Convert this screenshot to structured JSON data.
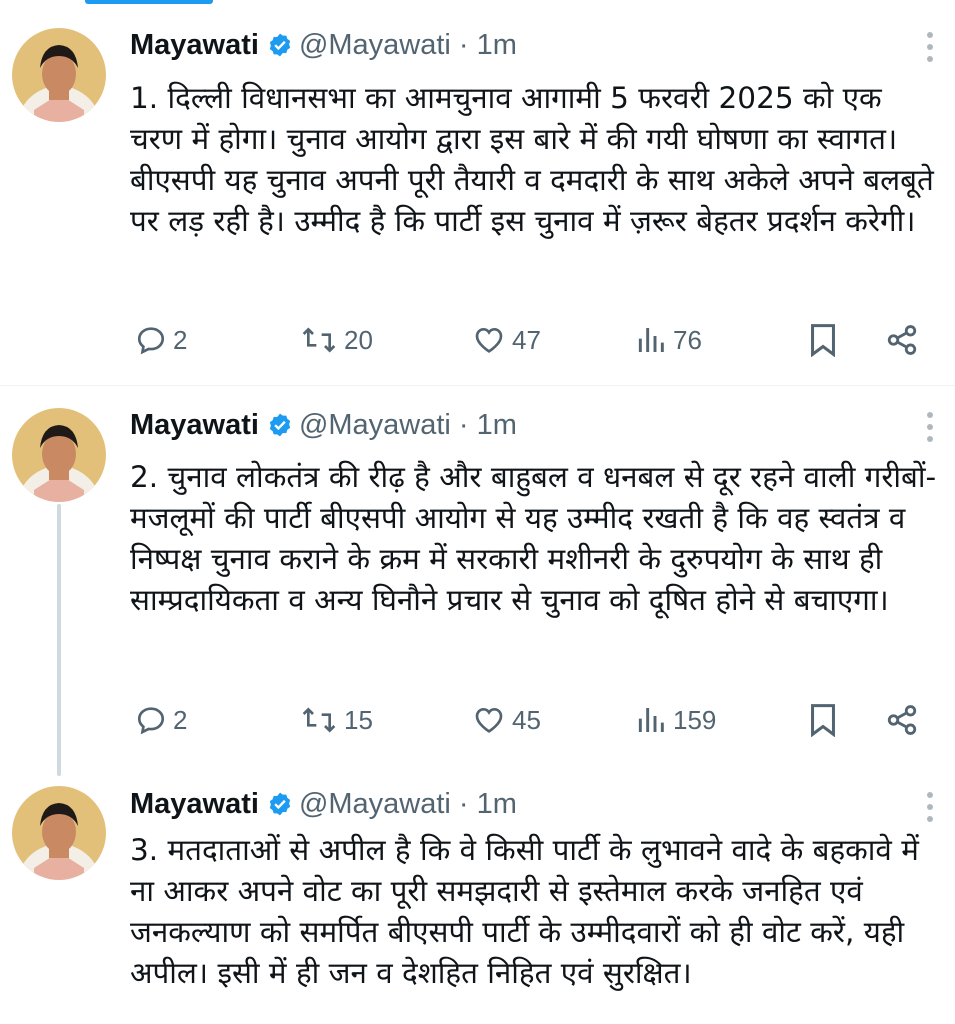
{
  "colors": {
    "accent": "#1d9bf0",
    "text": "#0f1419",
    "muted": "#536471",
    "divider": "#eff3f4",
    "thread": "#cfd9de"
  },
  "tweets": [
    {
      "name": "Mayawati",
      "handle": "@Mayawati",
      "separator": "·",
      "time": "1m",
      "text": "1. दिल्ली विधानसभा का आमचुनाव आगामी 5 फरवरी 2025 को एक चरण में होगा। चुनाव आयोग द्वारा इस बारे में की गयी घोषणा का स्वागत। बीएसपी यह चुनाव अपनी पूरी तैयारी व दमदारी के साथ अकेले अपने बलबूते पर लड़ रही है। उम्मीद है कि पार्टी इस चुनाव में ज़रूर बेहतर प्रदर्शन करेगी।",
      "replies": "2",
      "reposts": "20",
      "likes": "47",
      "views": "76"
    },
    {
      "name": "Mayawati",
      "handle": "@Mayawati",
      "separator": "·",
      "time": "1m",
      "text": "2. चुनाव लोकतंत्र की रीढ़ है और बाहुबल व धनबल से दूर रहने वाली गरीबों-मजलूमों की पार्टी बीएसपी आयोग से यह उम्मीद रखती है कि वह स्वतंत्र व निष्पक्ष चुनाव कराने के क्रम में सरकारी मशीनरी के दुरुपयोग के साथ ही साम्प्रदायिकता व अन्य घिनौने प्रचार से चुनाव को दूषित होने से बचाएगा।",
      "replies": "2",
      "reposts": "15",
      "likes": "45",
      "views": "159"
    },
    {
      "name": "Mayawati",
      "handle": "@Mayawati",
      "separator": "·",
      "time": "1m",
      "text": "3. मतदाताओं से अपील है कि वे किसी पार्टी के लुभावने वादे के बहकावे में ना आकर अपने वोट का पूरी समझदारी से इस्तेमाल करके जनहित एवं जनकल्याण को समर्पित बीएसपी पार्टी के उम्मीदवारों को ही वोट करें, यही अपील। इसी में ही जन व देशहित निहित एवं सुरक्षित।"
    }
  ],
  "icons": {
    "verified": "verified-badge-icon",
    "more": "more-vertical-icon",
    "reply": "reply-icon",
    "repost": "repost-icon",
    "like": "like-icon",
    "views": "views-icon",
    "bookmark": "bookmark-icon",
    "share": "share-icon"
  }
}
